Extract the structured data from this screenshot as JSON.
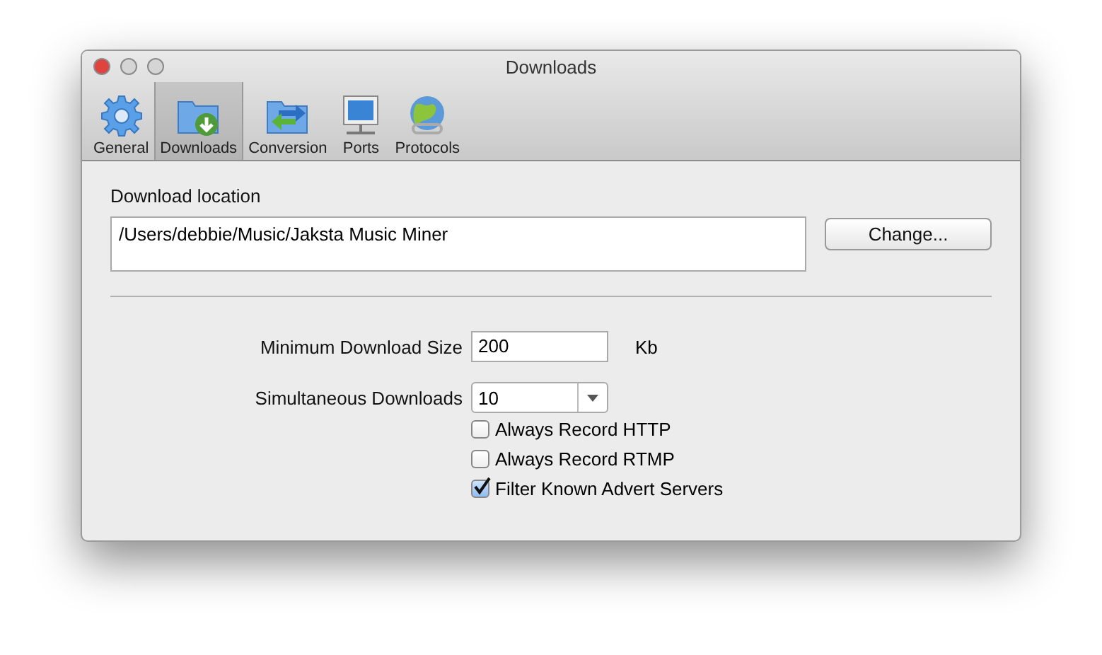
{
  "window": {
    "title": "Downloads"
  },
  "tabs": [
    {
      "label": "General",
      "kind": "gear",
      "selected": false
    },
    {
      "label": "Downloads",
      "kind": "download",
      "selected": true
    },
    {
      "label": "Conversion",
      "kind": "convert",
      "selected": false
    },
    {
      "label": "Ports",
      "kind": "monitor",
      "selected": false
    },
    {
      "label": "Protocols",
      "kind": "globe",
      "selected": false
    }
  ],
  "location": {
    "label": "Download location",
    "value": "/Users/debbie/Music/Jaksta Music Miner",
    "button": "Change..."
  },
  "min_size": {
    "label": "Minimum Download Size",
    "value": "200",
    "unit": "Kb"
  },
  "simultaneous": {
    "label": "Simultaneous Downloads",
    "value": "10"
  },
  "options": [
    {
      "label": "Always Record HTTP",
      "checked": false
    },
    {
      "label": "Always Record RTMP",
      "checked": false
    },
    {
      "label": "Filter Known Advert Servers",
      "checked": true
    }
  ]
}
